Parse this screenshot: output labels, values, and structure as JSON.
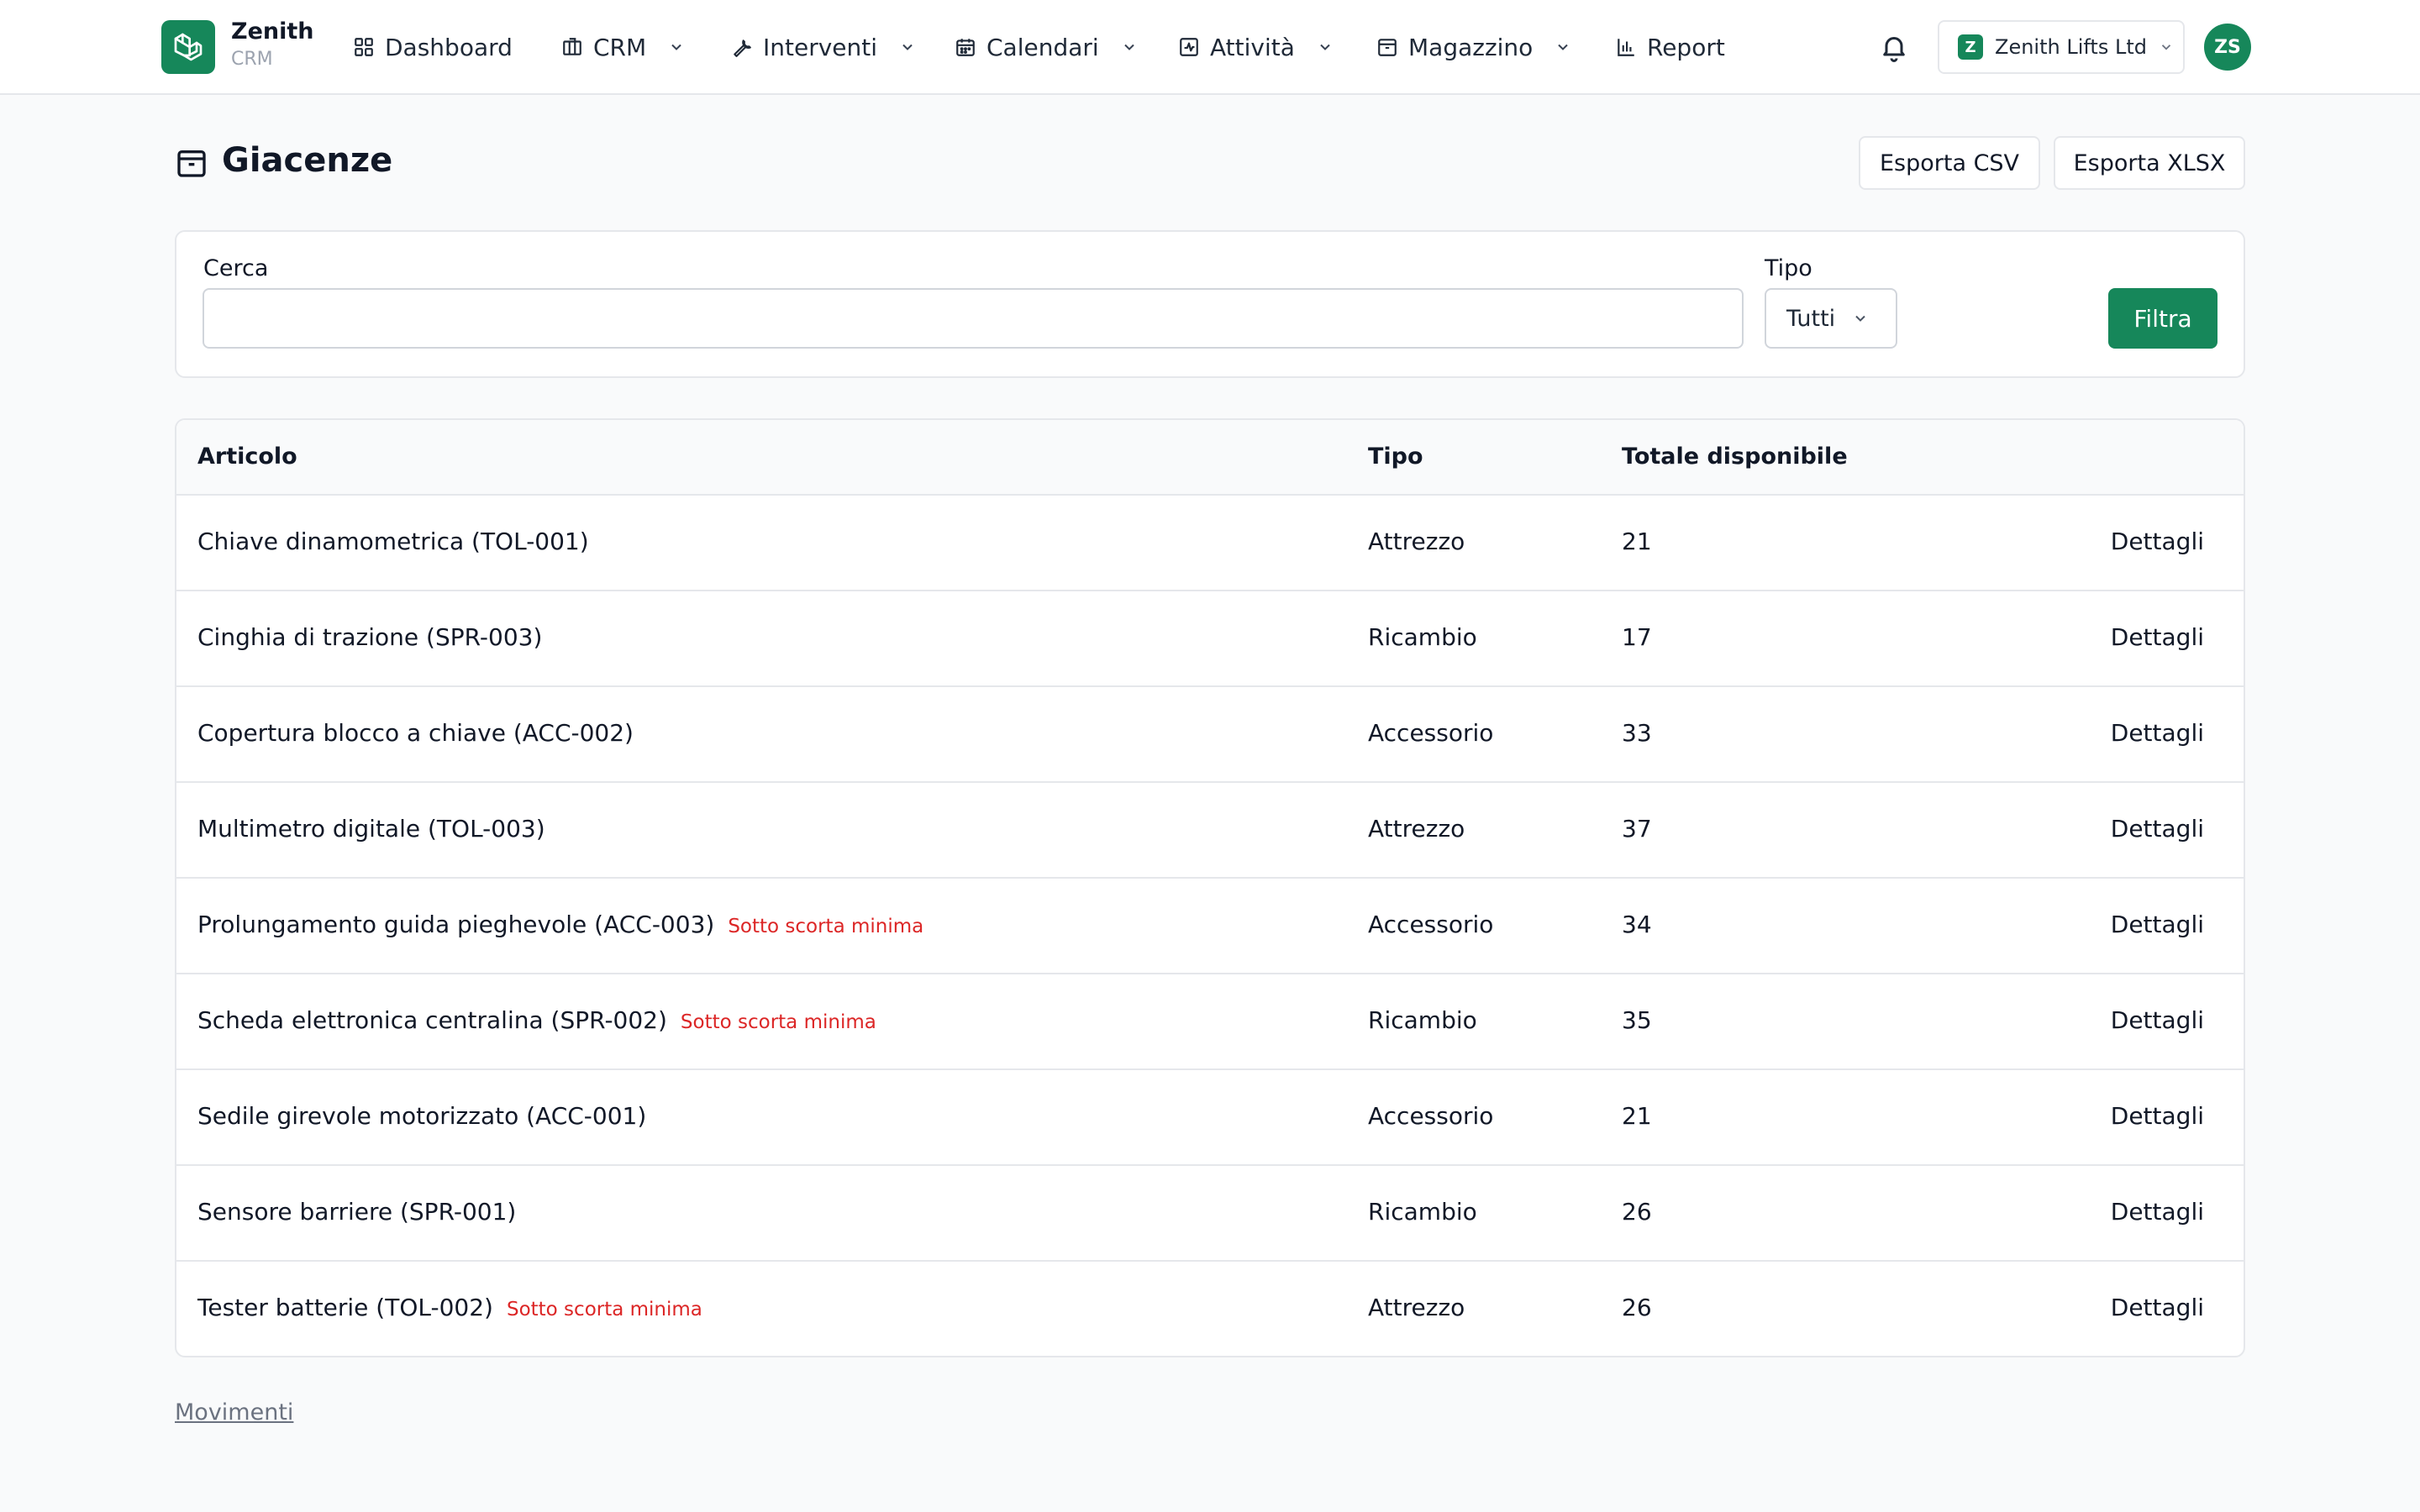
{
  "brand": {
    "name": "Zenith",
    "sub": "CRM"
  },
  "nav": [
    {
      "label": "Dashboard",
      "icon": "dashboard-grid-icon",
      "has_dropdown": false
    },
    {
      "label": "CRM",
      "icon": "building-icon",
      "has_dropdown": true
    },
    {
      "label": "Interventi",
      "icon": "wrench-icon",
      "has_dropdown": true
    },
    {
      "label": "Calendari",
      "icon": "calendar-icon",
      "has_dropdown": true
    },
    {
      "label": "Attività",
      "icon": "activity-icon",
      "has_dropdown": true
    },
    {
      "label": "Magazzino",
      "icon": "box-icon",
      "has_dropdown": true
    },
    {
      "label": "Report",
      "icon": "bar-chart-icon",
      "has_dropdown": false
    }
  ],
  "company": {
    "badge": "Z",
    "name": "Zenith Lifts Ltd"
  },
  "user": {
    "initials": "ZS"
  },
  "page": {
    "title": "Giacenze",
    "export_csv": "Esporta CSV",
    "export_xlsx": "Esporta XLSX"
  },
  "filters": {
    "search_label": "Cerca",
    "search_value": "",
    "search_placeholder": "",
    "type_label": "Tipo",
    "type_value": "Tutti",
    "submit": "Filtra"
  },
  "table": {
    "columns": [
      "Articolo",
      "Tipo",
      "Totale disponibile"
    ],
    "action_label": "Dettagli",
    "rows": [
      {
        "articolo": "Chiave dinamometrica (TOL-001)",
        "warning": "",
        "tipo": "Attrezzo",
        "totale": "21"
      },
      {
        "articolo": "Cinghia di trazione (SPR-003)",
        "warning": "",
        "tipo": "Ricambio",
        "totale": "17"
      },
      {
        "articolo": "Copertura blocco a chiave (ACC-002)",
        "warning": "",
        "tipo": "Accessorio",
        "totale": "33"
      },
      {
        "articolo": "Multimetro digitale (TOL-003)",
        "warning": "",
        "tipo": "Attrezzo",
        "totale": "37"
      },
      {
        "articolo": "Prolungamento guida pieghevole (ACC-003)",
        "warning": "Sotto scorta minima",
        "tipo": "Accessorio",
        "totale": "34"
      },
      {
        "articolo": "Scheda elettronica centralina (SPR-002)",
        "warning": "Sotto scorta minima",
        "tipo": "Ricambio",
        "totale": "35"
      },
      {
        "articolo": "Sedile girevole motorizzato (ACC-001)",
        "warning": "",
        "tipo": "Accessorio",
        "totale": "21"
      },
      {
        "articolo": "Sensore barriere (SPR-001)",
        "warning": "",
        "tipo": "Ricambio",
        "totale": "26"
      },
      {
        "articolo": "Tester batterie (TOL-002)",
        "warning": "Sotto scorta minima",
        "tipo": "Attrezzo",
        "totale": "26"
      }
    ]
  },
  "footer_link": "Movimenti",
  "colors": {
    "brand": "#16875a",
    "warning": "#dc2626",
    "border": "#e5e7eb"
  }
}
